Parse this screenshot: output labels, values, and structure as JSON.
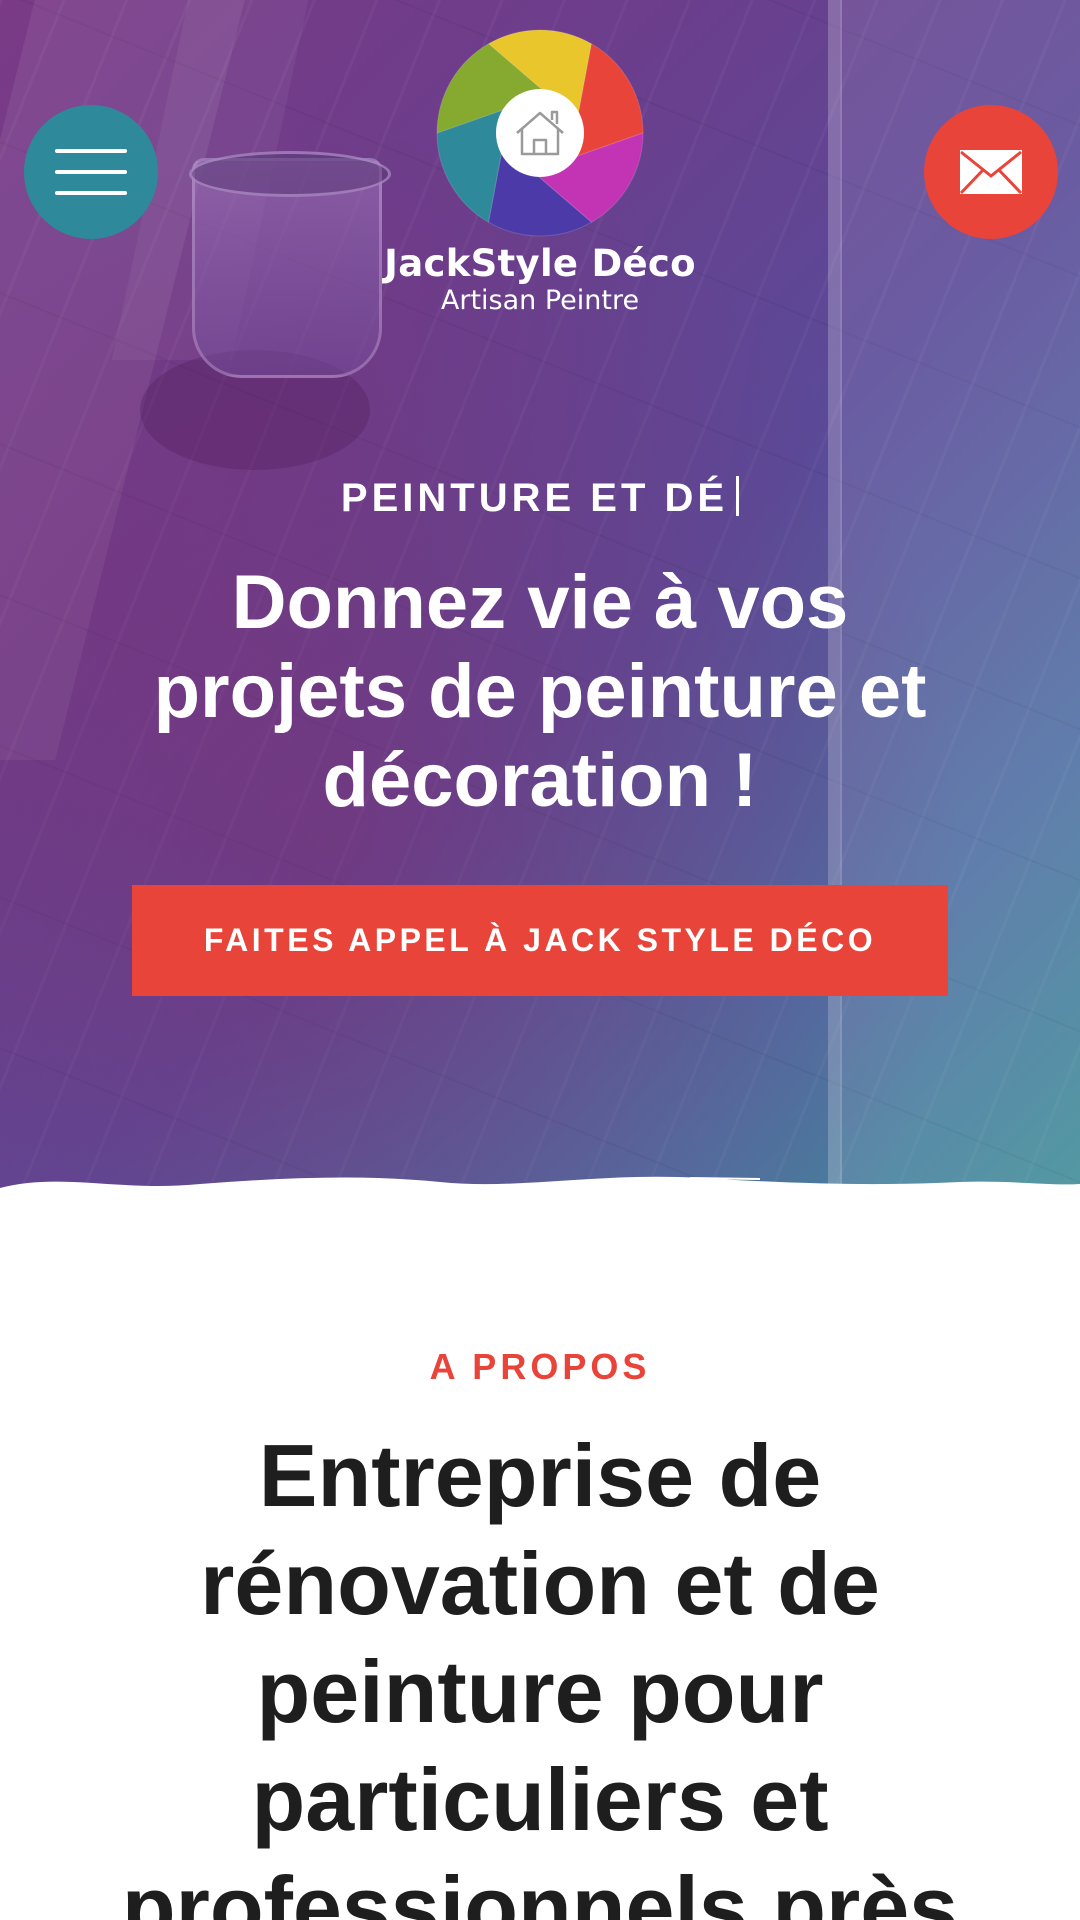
{
  "header": {
    "logo": {
      "name": "JackStyle Déco",
      "tagline": "Artisan Peintre",
      "icon": "house-icon",
      "aperture_colors": [
        "#e9c72c",
        "#e8443a",
        "#c334b4",
        "#4b3aa8",
        "#2e8a9a",
        "#86a92f"
      ]
    },
    "menu_button": {
      "icon": "hamburger-icon",
      "color": "#2e8a9a"
    },
    "contact_button": {
      "icon": "envelope-icon",
      "color": "#e8443a"
    }
  },
  "hero": {
    "eyebrow": "PEINTURE ET DÉ",
    "title": "Donnez vie à vos projets de peinture et décoration !",
    "cta_label": "FAITES APPEL À JACK STYLE DÉCO",
    "cta_color": "#e8443a"
  },
  "about": {
    "eyebrow": "A PROPOS",
    "title": "Entreprise de rénovation et de peinture pour particuliers et professionnels près",
    "accent_color": "#e8443a"
  }
}
